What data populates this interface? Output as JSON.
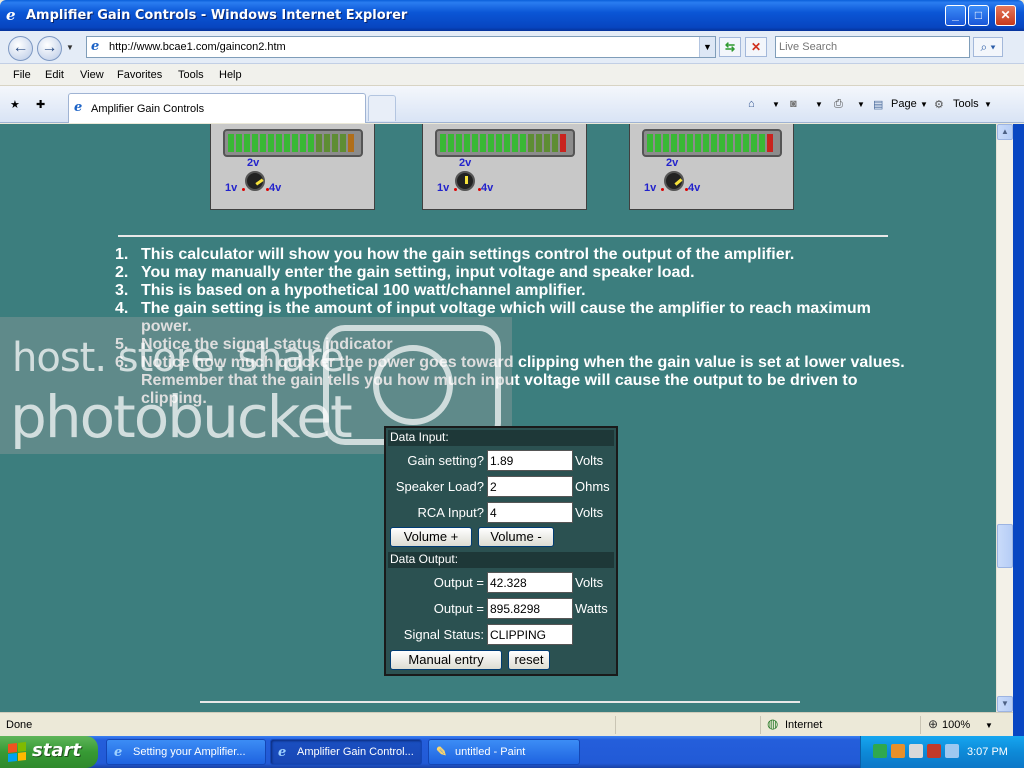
{
  "window": {
    "title": "Amplifier Gain Controls - Windows Internet Explorer"
  },
  "address": {
    "url": "http://www.bcae1.com/gaincon2.htm",
    "search_placeholder": "Live Search"
  },
  "menu": [
    "File",
    "Edit",
    "View",
    "Favorites",
    "Tools",
    "Help"
  ],
  "tab": {
    "label": "Amplifier Gain Controls"
  },
  "command_bar": {
    "page": "Page",
    "tools": "Tools"
  },
  "meters": [
    {
      "top_label": "2v",
      "left_label": "1v",
      "right_label": "4v",
      "lit": 11,
      "peak": "yellow"
    },
    {
      "top_label": "2v",
      "left_label": "1v",
      "right_label": "4v",
      "lit": 11,
      "peak": "red"
    },
    {
      "top_label": "2v",
      "left_label": "1v",
      "right_label": "4v",
      "lit": 15,
      "peak": "red"
    }
  ],
  "instructions": [
    {
      "num": "1.",
      "text": "This calculator will show you how the gain settings control the output of the amplifier."
    },
    {
      "num": "2.",
      "text": "You may manually enter the gain setting, input voltage and speaker load."
    },
    {
      "num": "3.",
      "text": "This is based on a hypothetical 100 watt/channel amplifier."
    },
    {
      "num": "4.",
      "text": "The gain setting is the amount of input voltage which will cause the amplifier to reach maximum power."
    },
    {
      "num": "5.",
      "text": "Notice the signal status indicator"
    },
    {
      "num": "6.",
      "text": "Notice how much quicker the power goes toward clipping when the gain value is set at lower values. Remember that the gain tells you how much input voltage will cause the output to be driven to clipping."
    }
  ],
  "calculator": {
    "input_heading": "Data Input:",
    "gain_label": "Gain setting?",
    "gain_value": "1.89",
    "gain_unit": "Volts",
    "load_label": "Speaker Load?",
    "load_value": "2",
    "load_unit": "Ohms",
    "rca_label": "RCA Input?",
    "rca_value": "4",
    "rca_unit": "Volts",
    "volume_up": "Volume +",
    "volume_down": "Volume -",
    "output_heading": "Data Output:",
    "volts_label": "Output =",
    "volts_value": "42.328",
    "volts_unit": "Volts",
    "watts_label": "Output =",
    "watts_value": "895.8298",
    "watts_unit": "Watts",
    "status_label": "Signal Status:",
    "status_value": "CLIPPING",
    "manual_entry": "Manual entry",
    "reset": "reset"
  },
  "watermark": {
    "line1": "host. store. share.",
    "line2": "photobucket"
  },
  "status": {
    "left": "Done",
    "zone": "Internet",
    "zoom": "100%"
  },
  "taskbar": {
    "start": "start",
    "tasks": [
      "Setting your Amplifier...",
      "Amplifier Gain Control...",
      "untitled - Paint"
    ],
    "clock": "3:07 PM"
  },
  "colors": {
    "page_bg": "#3c7e7e",
    "calc_bg": "#2b5151",
    "meter_green": "#39b835",
    "meter_red": "#c9231e"
  }
}
